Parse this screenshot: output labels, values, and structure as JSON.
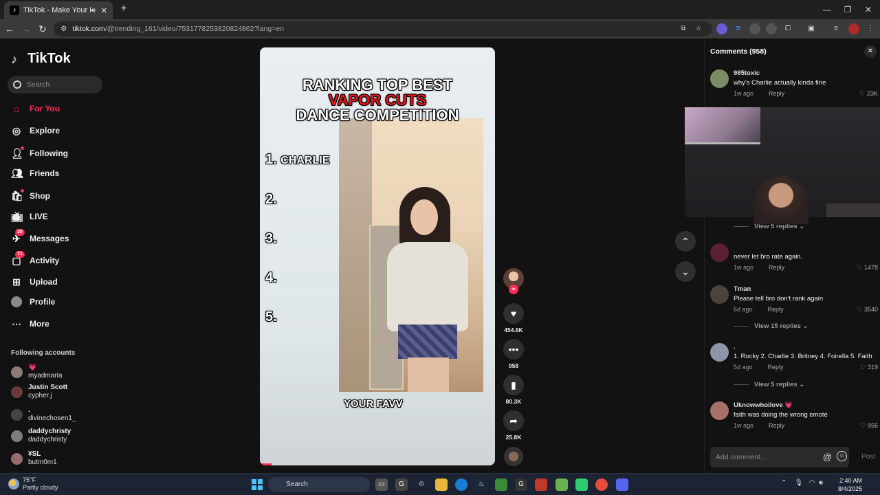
{
  "browser": {
    "tab_title": "TikTok - Make Your Day",
    "url_host": "tiktok.com",
    "url_path": "/@trending_161/video/7531778253820824862?lang=en"
  },
  "sidebar": {
    "logo": "TikTok",
    "search_placeholder": "Search",
    "nav": [
      {
        "label": "For You",
        "icon": "home-icon"
      },
      {
        "label": "Explore",
        "icon": "compass-icon"
      },
      {
        "label": "Following",
        "icon": "following-icon"
      },
      {
        "label": "Friends",
        "icon": "friends-icon"
      },
      {
        "label": "Shop",
        "icon": "shop-icon"
      },
      {
        "label": "LIVE",
        "icon": "live-icon"
      },
      {
        "label": "Messages",
        "icon": "messages-icon",
        "badge": "20"
      },
      {
        "label": "Activity",
        "icon": "activity-icon",
        "badge": "71"
      },
      {
        "label": "Upload",
        "icon": "upload-icon"
      },
      {
        "label": "Profile",
        "icon": "profile-avatar"
      },
      {
        "label": "More",
        "icon": "more-icon"
      }
    ],
    "following_title": "Following accounts",
    "following": [
      {
        "name": "💗",
        "handle": "myadmaria"
      },
      {
        "name": "Justin Scott",
        "handle": "cypher.j"
      },
      {
        "name": ".",
        "handle": "divinechosen1_"
      },
      {
        "name": "daddychristy",
        "handle": "daddychristy"
      },
      {
        "name": "¥SL",
        "handle": "butm0m1"
      }
    ]
  },
  "video": {
    "title_line1": "RANKING TOP BEST",
    "title_line2": "VAPOR CUTS",
    "title_line3": "DANCE COMPETITION",
    "ranks": [
      "1.",
      "2.",
      "3.",
      "4.",
      "5."
    ],
    "rank1_name": "CHARLIE",
    "caption": "YOUR FAVV",
    "likes": "454.6K",
    "comments": "958",
    "saves": "80.3K",
    "shares": "25.8K",
    "progress_fraction": 0.05
  },
  "comments_panel": {
    "title": "Comments (958)",
    "input_placeholder": "Add comment...",
    "post_label": "Post",
    "reply_label": "Reply",
    "items": [
      {
        "user": "985toxic",
        "text": "why's Charlie actually kinda fine",
        "time": "1w ago",
        "likes": "23K"
      },
      {
        "user": "",
        "text": "never let bro rate again.",
        "time": "1w ago",
        "likes": "1478"
      },
      {
        "user": "Tman",
        "text": "Please tell bro don't rank again",
        "time": "6d ago",
        "likes": "3540"
      },
      {
        "user": ".",
        "text": "1. Rocky 2. Charlie 3. Britney 4. Foirella 5. Faith",
        "time": "5d ago",
        "likes": "319"
      },
      {
        "user": "Uknowwhoilove 💗",
        "text": "faith was doing the wrong emote",
        "time": "1w ago",
        "likes": "956"
      }
    ],
    "view_replies": [
      "View 5 replies",
      "View 15 replies",
      "View 5 replies"
    ]
  },
  "taskbar": {
    "temp": "75°F",
    "weather": "Partly cloudy",
    "search": "Search",
    "time": "2:40 AM",
    "date": "8/4/2025"
  },
  "colors": {
    "accent": "#fe2c55",
    "background": "#121212"
  }
}
